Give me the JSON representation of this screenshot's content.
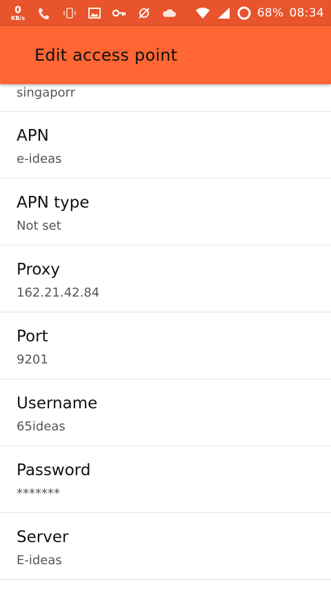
{
  "status_bar": {
    "net_speed_value": "0",
    "net_speed_unit": "KB/s",
    "battery_percent": "68%",
    "time": "08:34",
    "icons": [
      "phone-signal-icon",
      "vibrate-icon",
      "image-icon",
      "key-icon",
      "sync-off-icon",
      "cloud-icon",
      "wifi-icon",
      "cell-signal-icon",
      "battery-ring-icon"
    ]
  },
  "app_bar": {
    "title": "Edit access point"
  },
  "partial_item": {
    "value": "singaporr"
  },
  "items": [
    {
      "label": "APN",
      "value": "e-ideas"
    },
    {
      "label": "APN type",
      "value": "Not set"
    },
    {
      "label": "Proxy",
      "value": "162.21.42.84"
    },
    {
      "label": "Port",
      "value": "9201"
    },
    {
      "label": "Username",
      "value": "65ideas"
    },
    {
      "label": "Password",
      "value": "*******"
    },
    {
      "label": "Server",
      "value": "E-ideas"
    }
  ],
  "colors": {
    "status_bar": "#e8542c",
    "app_bar": "#ff6633",
    "label": "#111111",
    "value": "#555555",
    "divider": "#e2e2e2"
  }
}
